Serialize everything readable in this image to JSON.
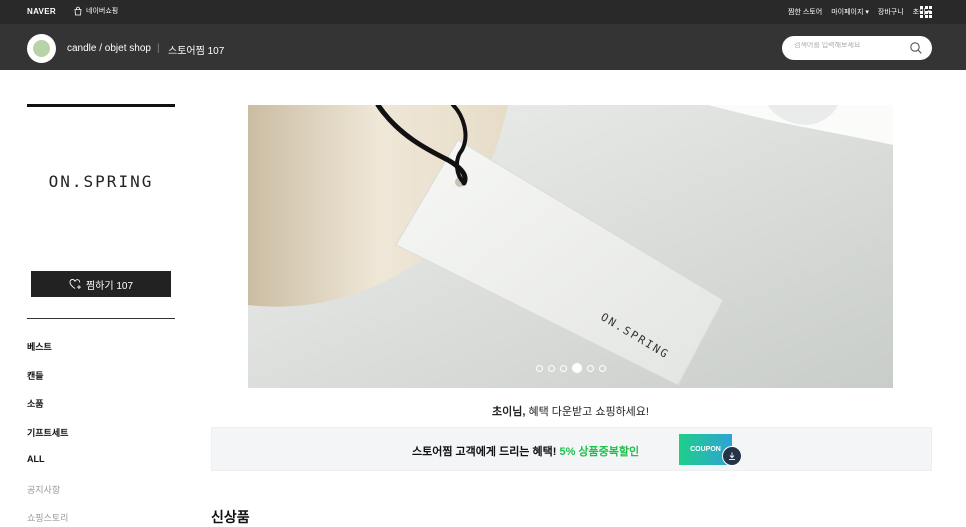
{
  "gnb": {
    "naver": "NAVER",
    "shopping": "네이버쇼핑",
    "links": [
      "찜한 스토어",
      "마이페이지",
      "장바구니",
      "초이"
    ],
    "apps_icon": "grid-icon"
  },
  "store": {
    "name": "candle / objet shop",
    "separator": "|",
    "favorite_text": "스토어찜 107",
    "search_placeholder": "검색어를 입력해보세요"
  },
  "sidebar": {
    "brand": "ON.SPRING",
    "zzim_label": "찜하기 107",
    "categories": [
      "베스트",
      "캔들",
      "소품",
      "기프트세트",
      "ALL",
      "공지사항",
      "쇼핑스토리"
    ]
  },
  "banner": {
    "tag_text": "ON.SPRING",
    "slide_count": 6,
    "active_slide": 4
  },
  "greeting": {
    "name": "초이님,",
    "message": " 혜택 다운받고 쇼핑하세요!"
  },
  "coupon": {
    "text": "스토어찜 고객에게 드리는 혜택!",
    "highlight": "5% 상품중복할인",
    "button": "COUPON"
  },
  "section": {
    "title": "신상품"
  },
  "colors": {
    "header_dark": "#292929",
    "store_bar": "#343434",
    "accent_green": "#1fbf4c",
    "coupon_gradient_start": "#1fcf89",
    "coupon_gradient_end": "#2ea2d6"
  }
}
